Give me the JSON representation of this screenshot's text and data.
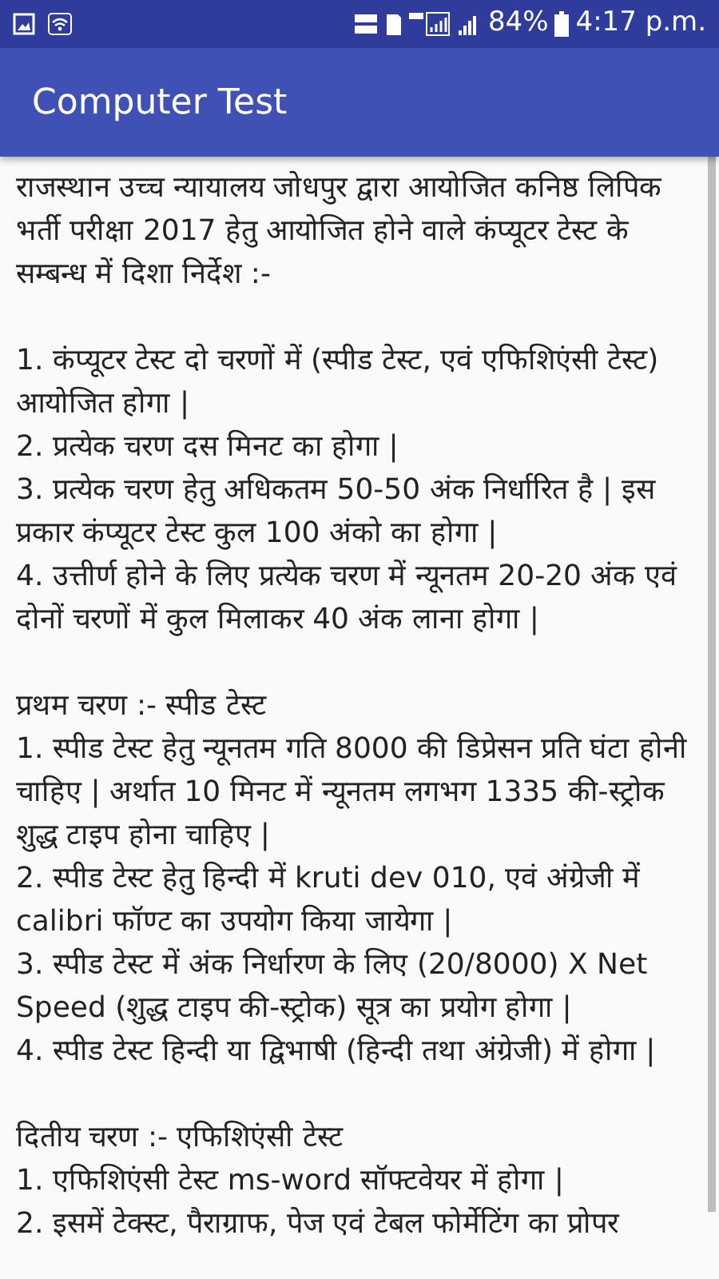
{
  "status_bar": {
    "battery": "84%",
    "time": "4:17 p.m."
  },
  "app_bar": {
    "title": "Computer Test"
  },
  "blocks": [
    [
      "राजस्थान उच्च न्यायालय जोधपुर द्वारा आयोजित कनिष्ठ लिपिक भर्ती परीक्षा 2017 हेतु आयोजित होने वाले कंप्यूटर टेस्ट के सम्बन्ध में दिशा निर्देश :-"
    ],
    [
      "1. कंप्यूटर टेस्ट दो चरणों में (स्पीड टेस्ट, एवं एफिशिएंसी टेस्ट) आयोजित होगा |",
      "2. प्रत्येक चरण दस मिनट का होगा |",
      "3. प्रत्येक चरण हेतु अधिकतम 50-50 अंक निर्धारित है | इस प्रकार कंप्यूटर टेस्ट कुल 100 अंको का होगा |",
      "4. उत्तीर्ण होने के लिए प्रत्येक चरण में न्यूनतम 20-20 अंक एवं दोनों चरणों में कुल मिलाकर 40 अंक लाना होगा |"
    ],
    [
      "प्रथम चरण :- स्पीड टेस्ट",
      "1. स्पीड टेस्ट हेतु न्यूनतम गति 8000 की डिप्रेसन प्रति घंटा होनी चाहिए | अर्थात 10 मिनट में न्यूनतम लगभग 1335 की-स्ट्रोक शुद्ध टाइप होना चाहिए |",
      "2. स्पीड टेस्ट हेतु हिन्दी में kruti dev 010, एवं अंग्रेजी में calibri फॉण्ट का उपयोग किया जायेगा |",
      "3. स्पीड टेस्ट में अंक निर्धारण के लिए (20/8000) X Net Speed (शुद्ध टाइप की-स्ट्रोक) सूत्र का प्रयोग होगा |",
      "4. स्पीड टेस्ट हिन्दी या द्विभाषी (हिन्दी तथा अंग्रेजी) में होगा |"
    ],
    [
      "दितीय चरण :- एफिशिएंसी टेस्ट",
      "1. एफिशिएंसी टेस्ट ms-word सॉफ्टवेयर में होगा |",
      "2. इसमें टेक्स्ट, पैराग्राफ, पेज एवं टेबल फोर्मेटिंग का प्रोपर"
    ]
  ]
}
